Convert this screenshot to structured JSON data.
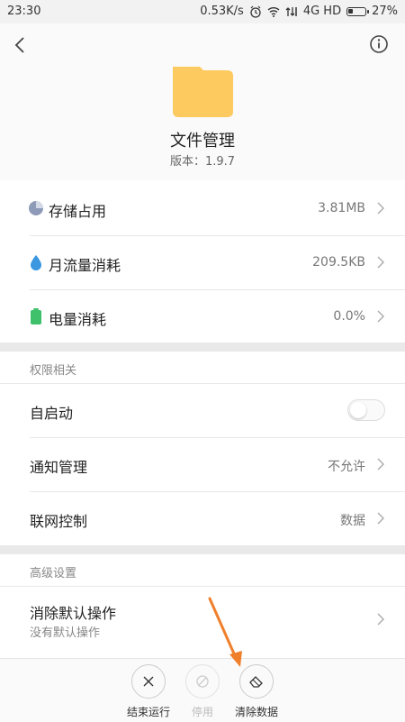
{
  "status_bar": {
    "time": "23:30",
    "speed": "0.53K/s",
    "network": "4G HD",
    "battery": "27%",
    "battery_level": 0.27
  },
  "app": {
    "name": "文件管理",
    "version": "版本：1.9.7"
  },
  "usage": [
    {
      "label": "存储占用",
      "value": "3.81MB",
      "icon": "storage-pie-icon"
    },
    {
      "label": "月流量消耗",
      "value": "209.5KB",
      "icon": "water-drop-icon"
    },
    {
      "label": "电量消耗",
      "value": "0.0%",
      "icon": "battery-icon"
    }
  ],
  "permissions": {
    "title": "权限相关",
    "autostart": "自启动",
    "autostart_enabled": false,
    "notification": {
      "label": "通知管理",
      "value": "不允许"
    },
    "network": {
      "label": "联网控制",
      "value": "数据"
    }
  },
  "advanced": {
    "title": "高级设置",
    "clear_defaults": "消除默认操作",
    "clear_defaults_sub": "没有默认操作"
  },
  "actions": {
    "force_stop": "结束运行",
    "disable": "停用",
    "clear_data": "清除数据"
  },
  "colors": {
    "folder": "#fcca5f",
    "storage_icon": "#8e9bb8",
    "drop_icon": "#3a97e0",
    "battery_icon": "#3fc06a",
    "annotation_arrow": "#f07f2b"
  }
}
